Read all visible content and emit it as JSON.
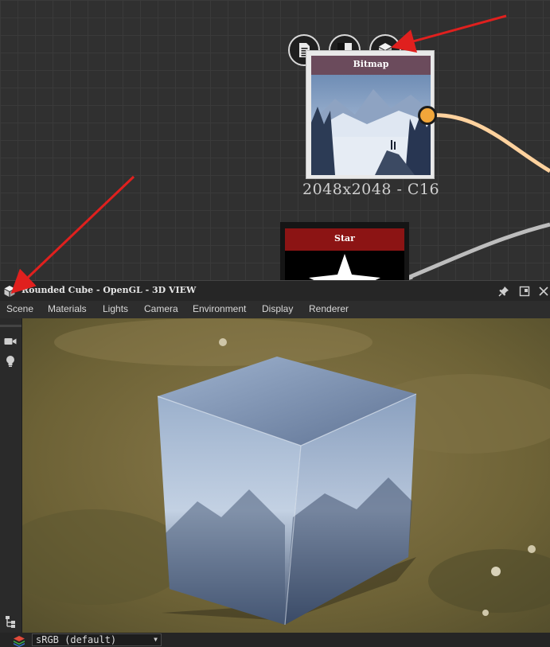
{
  "graph": {
    "bitmap_node": {
      "title": "Bitmap",
      "size_label": "2048x2048 - C16"
    },
    "star_node": {
      "title": "Star"
    },
    "node_toolbar": [
      "document-icon",
      "checker-icon",
      "cube-icon"
    ],
    "colors": {
      "output_port": "#f2a63a",
      "bitmap_header": "#6b4b5c",
      "star_header": "#8c1414",
      "annotation_arrow": "#e0201e"
    }
  },
  "panel": {
    "title": "Rounded Cube - OpenGL - 3D VIEW",
    "menu": [
      "Scene",
      "Materials",
      "Lights",
      "Camera",
      "Environment",
      "Display",
      "Renderer"
    ],
    "tools": [
      "camera-icon",
      "light-bulb-icon"
    ],
    "colorspace": {
      "value": "sRGB (default)"
    }
  }
}
